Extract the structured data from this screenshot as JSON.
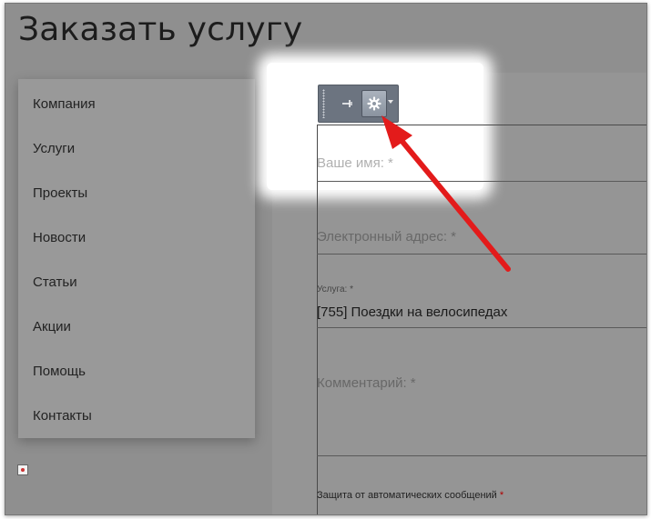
{
  "page": {
    "title": "Заказать услугу"
  },
  "sidebar": {
    "items": [
      {
        "label": "Компания"
      },
      {
        "label": "Услуги"
      },
      {
        "label": "Проекты"
      },
      {
        "label": "Новости"
      },
      {
        "label": "Статьи"
      },
      {
        "label": "Акции"
      },
      {
        "label": "Помощь"
      },
      {
        "label": "Контакты"
      }
    ]
  },
  "form": {
    "name_placeholder": "Ваше имя: *",
    "email_placeholder": "Электронный адрес: *",
    "service_label": "Услуга: *",
    "service_value": "[755] Поездки на велосипедах",
    "comment_placeholder": "Комментарий: *",
    "captcha_label": "Защита от автоматических сообщений",
    "captcha_required": "*"
  },
  "toolbar": {
    "icons": [
      "grip-handle-icon",
      "pin-icon",
      "gear-icon",
      "chevron-down-icon"
    ]
  },
  "annotation": {
    "arrow_color": "#e31b1b"
  }
}
